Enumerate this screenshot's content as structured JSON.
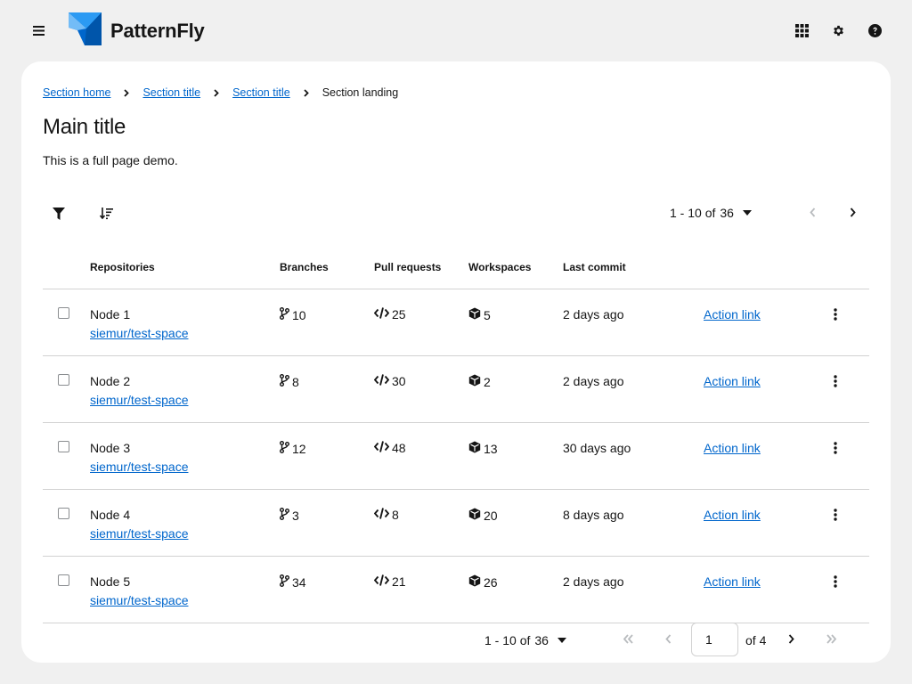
{
  "app": {
    "logo_text": "PatternFly"
  },
  "breadcrumb": {
    "items": [
      "Section home",
      "Section title",
      "Section title"
    ],
    "current": "Section landing"
  },
  "page": {
    "title": "Main title",
    "description": "This is a full page demo."
  },
  "pagination": {
    "range": "1 - 10 of",
    "total": "36",
    "page_value": "1",
    "of_pages": "of 4"
  },
  "table": {
    "headers": [
      "Repositories",
      "Branches",
      "Pull requests",
      "Workspaces",
      "Last commit"
    ],
    "rows": [
      {
        "name": "Node 1",
        "link": "siemur/test-space",
        "branches": "10",
        "prs": "25",
        "workspaces": "5",
        "last_commit": "2 days ago",
        "action": "Action link"
      },
      {
        "name": "Node 2",
        "link": "siemur/test-space",
        "branches": "8",
        "prs": "30",
        "workspaces": "2",
        "last_commit": "2 days ago",
        "action": "Action link"
      },
      {
        "name": "Node 3",
        "link": "siemur/test-space",
        "branches": "12",
        "prs": "48",
        "workspaces": "13",
        "last_commit": "30 days ago",
        "action": "Action link"
      },
      {
        "name": "Node 4",
        "link": "siemur/test-space",
        "branches": "3",
        "prs": "8",
        "workspaces": "20",
        "last_commit": "8 days ago",
        "action": "Action link"
      },
      {
        "name": "Node 5",
        "link": "siemur/test-space",
        "branches": "34",
        "prs": "21",
        "workspaces": "26",
        "last_commit": "2 days ago",
        "action": "Action link"
      }
    ]
  },
  "icons": {
    "menu": "hamburger-icon",
    "apps": "grid-icon",
    "settings": "gear-icon",
    "help": "question-circle-icon",
    "filter": "filter-icon",
    "sort": "sort-amount-down-icon",
    "branch": "code-branch-icon",
    "pr": "code-icon",
    "workspace": "cube-icon",
    "kebab": "ellipsis-vertical-icon"
  },
  "colors": {
    "link": "#0066cc",
    "background": "#f0f0f0",
    "text": "#151515",
    "disabled": "#8a8d90"
  }
}
